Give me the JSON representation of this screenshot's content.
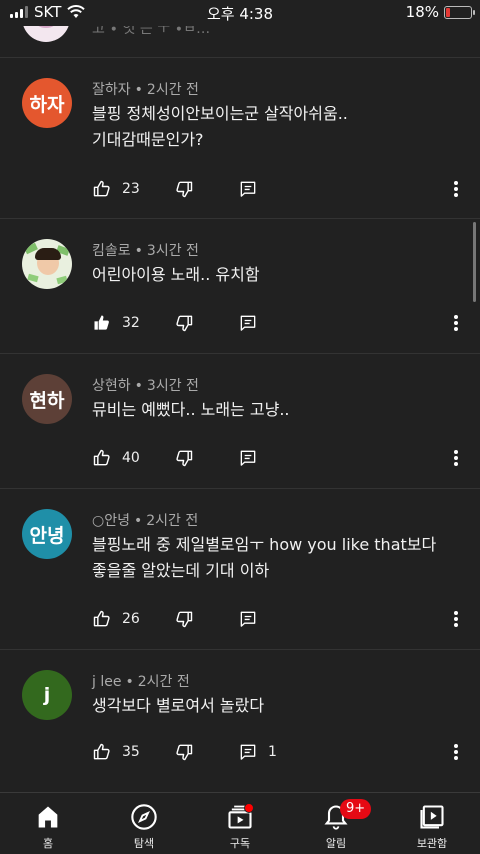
{
  "status_bar": {
    "carrier": "SKT",
    "time": "오후 4:38",
    "battery_text": "18%",
    "battery_level": 0.18,
    "battery_color": "#e53935"
  },
  "partial_comment": {
    "text": "고 ∙ 엇 는 ㅜ ∙ㅂ…"
  },
  "comments": [
    {
      "author": "잘하자",
      "time": "2시간 전",
      "avatar_text": "하자",
      "avatar_color": "#e4572e",
      "text": "블핑 정체성이안보이는군 살작아쉬움..\n기대감때문인가?",
      "likes": "23",
      "replies": ""
    },
    {
      "author": "킴솔로",
      "time": "3시간 전",
      "avatar_text": "",
      "avatar_color": "#e9f0df",
      "text": "어린아이용 노래..  유치함",
      "likes": "32",
      "liked": true,
      "replies": ""
    },
    {
      "author": "상현하",
      "time": "3시간 전",
      "avatar_text": "현하",
      "avatar_color": "#5d4037",
      "text": "뮤비는 예뻤다.. 노래는 고냥..",
      "likes": "40",
      "replies": ""
    },
    {
      "author": "○안녕",
      "time": "2시간 전",
      "avatar_text": "안녕",
      "avatar_color": "#1f8fa8",
      "text": "블핑노래 중 제일별로임ㅜ how you like that보다\n좋을줄 알았는데 기대 이하",
      "likes": "26",
      "replies": ""
    },
    {
      "author": "j lee",
      "time": "2시간 전",
      "avatar_text": "j",
      "avatar_color": "#33691e",
      "text": "생각보다 별로여서 놀랐다",
      "likes": "35",
      "replies": "1"
    }
  ],
  "bottom_nav": [
    {
      "label": "홈",
      "icon": "home-icon",
      "active": true
    },
    {
      "label": "탐색",
      "icon": "compass-icon"
    },
    {
      "label": "구독",
      "icon": "subscriptions-icon",
      "dot": true
    },
    {
      "label": "알림",
      "icon": "bell-icon",
      "badge": "9+"
    },
    {
      "label": "보관함",
      "icon": "library-icon"
    }
  ]
}
